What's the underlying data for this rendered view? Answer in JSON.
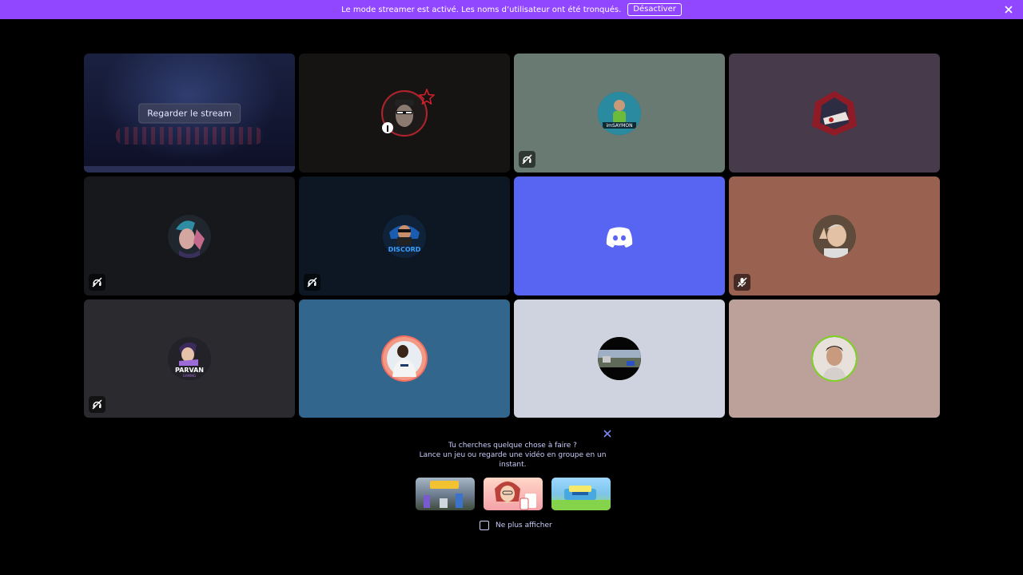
{
  "banner": {
    "message": "Le mode streamer est activé. Les noms d’utilisateur ont été tronqués.",
    "disable_label": "Désactiver"
  },
  "tiles": [
    {
      "kind": "stream",
      "watch_label": "Regarder le stream"
    },
    {
      "kind": "user",
      "bg": "#151413",
      "avatar": "ghost-face",
      "muted": false
    },
    {
      "kind": "user",
      "bg": "#687a72",
      "avatar": "saymon",
      "avatar_text": "imSAYMON",
      "muted": true
    },
    {
      "kind": "user",
      "bg": "#473a4b",
      "avatar": "red-emblem",
      "muted": false
    },
    {
      "kind": "user",
      "bg": "#16181c",
      "avatar": "anime",
      "muted": true
    },
    {
      "kind": "user",
      "bg": "#0d1723",
      "avatar": "discord-guy",
      "avatar_text": "DISCORD",
      "muted": true
    },
    {
      "kind": "user",
      "bg": "#5865f2",
      "avatar": "discord-logo",
      "muted": false
    },
    {
      "kind": "user",
      "bg": "#99614f",
      "avatar": "old-man",
      "muted": true
    },
    {
      "kind": "user",
      "bg": "#2b2a2e",
      "avatar": "parvan",
      "avatar_text": "PARVAN",
      "avatar_sub": "GAMING",
      "muted": true
    },
    {
      "kind": "user",
      "bg": "#33668c",
      "avatar": "player",
      "muted": false
    },
    {
      "kind": "user",
      "bg": "#cfd3e0",
      "avatar": "landscape",
      "muted": false
    },
    {
      "kind": "user",
      "bg": "#bba199",
      "avatar": "selfie",
      "muted": false
    }
  ],
  "suggestion": {
    "line1": "Tu cherches quelque chose à faire ?",
    "line2": "Lance un jeu ou regarde une vidéo en groupe en un instant.",
    "games": [
      {
        "name": "strike-game",
        "color": "#6b7a8c"
      },
      {
        "name": "cards-game",
        "color": "#f4a1a8"
      },
      {
        "name": "tower-game",
        "color": "#7cc4e8"
      }
    ],
    "dont_show_label": "Ne plus afficher"
  }
}
